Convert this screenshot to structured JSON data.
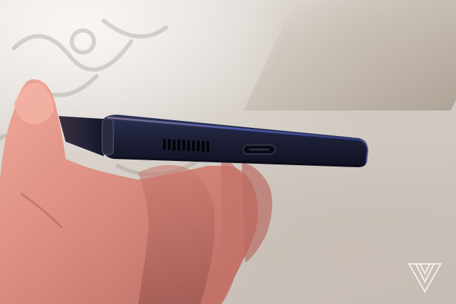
{
  "scene": {
    "subject": "phone-bottom-edge-with-speaker-grille-and-usb-c-port",
    "background_color": "#d6cfc8",
    "phone_body_color": "#1d2037",
    "skin_color": "#d98a7e",
    "watermark_icon": "the-verge-logo-icon"
  }
}
